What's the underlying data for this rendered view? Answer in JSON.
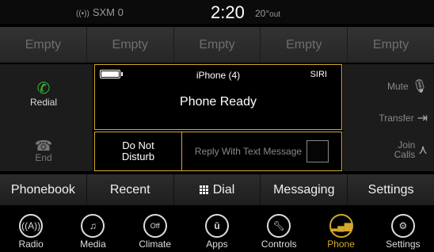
{
  "status_bar": {
    "radio_source": "SXM 0",
    "time": "2:20",
    "temperature": "20°",
    "temp_note": "out"
  },
  "presets": [
    "Empty",
    "Empty",
    "Empty",
    "Empty",
    "Empty"
  ],
  "left_buttons": {
    "redial_label": "Redial",
    "end_label": "End"
  },
  "right_buttons": {
    "mute_label": "Mute",
    "transfer_label": "Transfer",
    "join_label_line1": "Join",
    "join_label_line2": "Calls"
  },
  "main_panel": {
    "phone_name": "iPhone (4)",
    "siri_label": "SIRI",
    "status_text": "Phone Ready",
    "battery_level": 1.0
  },
  "sub_row": {
    "dnd_line1": "Do Not",
    "dnd_line2": "Disturb",
    "reply_label": "Reply With Text Message"
  },
  "tabs": [
    "Phonebook",
    "Recent",
    "Dial",
    "Messaging",
    "Settings"
  ],
  "dock": [
    {
      "label": "Radio",
      "icon": "radio-icon"
    },
    {
      "label": "Media",
      "icon": "music-note-icon"
    },
    {
      "label": "Climate",
      "icon": "climate-off-icon",
      "icon_text": "Off"
    },
    {
      "label": "Apps",
      "icon": "apps-icon"
    },
    {
      "label": "Controls",
      "icon": "wrench-icon"
    },
    {
      "label": "Phone",
      "icon": "phone-signal-icon",
      "active": true
    },
    {
      "label": "Settings",
      "icon": "gear-icon"
    }
  ],
  "colors": {
    "accent": "#d4a828",
    "redial_green": "#2ec22e"
  }
}
